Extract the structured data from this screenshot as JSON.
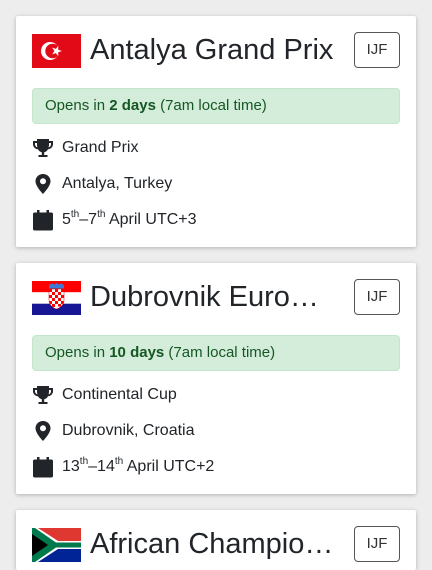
{
  "events": [
    {
      "title": "Antalya Grand Prix",
      "org_button": "IJF",
      "opens": {
        "prefix": "Opens in ",
        "days": "2 days",
        "suffix": " (7am local time)"
      },
      "type": "Grand Prix",
      "location": "Antalya, Turkey",
      "date": {
        "start": "5",
        "start_sup": "th",
        "dash": "–",
        "end": "7",
        "end_sup": "th",
        "rest": " April UTC+3"
      },
      "flag": "turkey-flag"
    },
    {
      "title": "Dubrovnik European Cup",
      "org_button": "IJF",
      "opens": {
        "prefix": "Opens in ",
        "days": "10 days",
        "suffix": " (7am local time)"
      },
      "type": "Continental Cup",
      "location": "Dubrovnik, Croatia",
      "date": {
        "start": "13",
        "start_sup": "th",
        "dash": "–",
        "end": "14",
        "end_sup": "th",
        "rest": " April UTC+2"
      },
      "flag": "croatia-flag"
    },
    {
      "title": "African Championships",
      "org_button": "IJF",
      "flag": "south-africa-flag"
    }
  ],
  "icons": [
    "trophy-icon",
    "map-marker-icon",
    "calendar-icon"
  ],
  "colors": {
    "opens_bg": "#d4edda",
    "opens_text": "#155724",
    "icon": "#212529"
  }
}
